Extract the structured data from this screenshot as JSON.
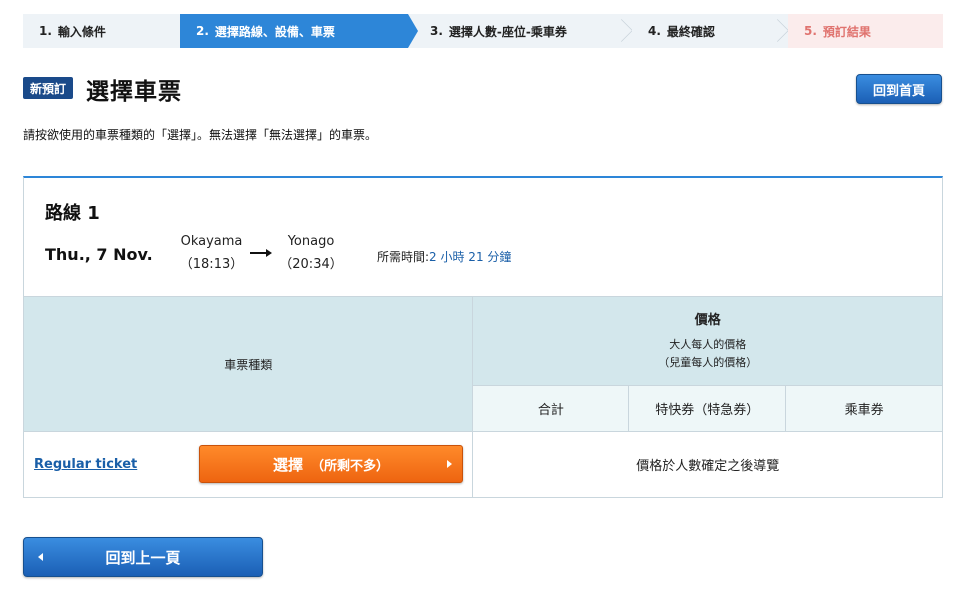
{
  "steps": [
    {
      "num": "1.",
      "label": "輸入條件",
      "state": "done"
    },
    {
      "num": "2.",
      "label": "選擇路線、設備、車票",
      "state": "active"
    },
    {
      "num": "3.",
      "label": "選擇人數-座位-乘車券",
      "state": "todo"
    },
    {
      "num": "4.",
      "label": "最終確認",
      "state": "todo"
    },
    {
      "num": "5.",
      "label": "預訂結果",
      "state": "todo"
    }
  ],
  "header": {
    "badge": "新預訂",
    "title": "選擇車票",
    "home_button": "回到首頁"
  },
  "instruction": "請按欲使用的車票種類的「選擇」。無法選擇「無法選擇」的車票。",
  "route": {
    "title": "路線 1",
    "date": "Thu., 7 Nov.",
    "departure": {
      "station": "Okayama",
      "time": "（18:13）"
    },
    "arrival": {
      "station": "Yonago",
      "time": "（20:34）"
    },
    "duration_label": "所需時間:",
    "duration_value": "2 小時 21 分鐘"
  },
  "table": {
    "type_header": "車票種類",
    "price_header": "價格",
    "price_note_adult": "大人每人的價格",
    "price_note_child": "（兒童每人的價格）",
    "sub_headers": [
      "合計",
      "特快券（特急券）",
      "乘車券"
    ],
    "rows": [
      {
        "ticket_name": "Regular ticket",
        "select_label": "選擇",
        "select_note": "（所剩不多）",
        "price_text": "價格於人數確定之後導覽"
      }
    ]
  },
  "back_button": "回到上一頁",
  "colors": {
    "active_step": "#2d86d8",
    "final_step_bg": "#fbecec",
    "final_step_text": "#e0736f",
    "badge": "#1a4a8a",
    "select_button": "#ee6410",
    "link": "#1a5fa8",
    "table_header": "#d3e7ec"
  }
}
